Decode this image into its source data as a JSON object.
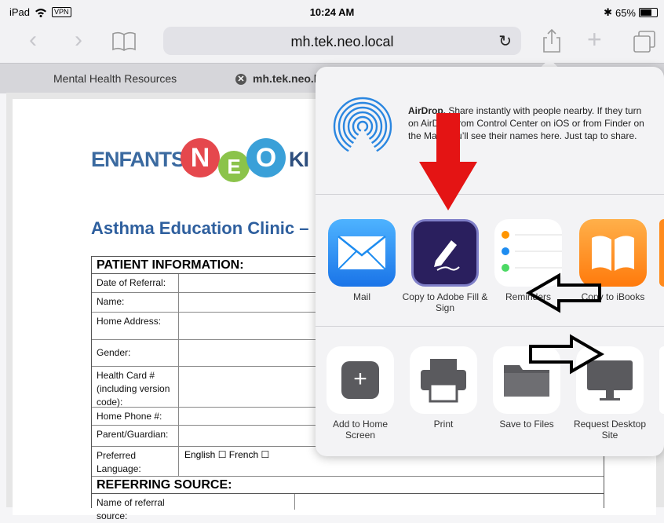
{
  "status_bar": {
    "device": "iPad",
    "vpn": "VPN",
    "time": "10:24 AM",
    "battery": "65%",
    "battery_level": 0.65
  },
  "toolbar": {
    "url": "mh.tek.neo.local"
  },
  "tabs": [
    {
      "label": "Mental Health Resources"
    },
    {
      "label": "mh.tek.neo.l"
    }
  ],
  "document": {
    "logo_prefix": "ENFANTS",
    "logo_letters": [
      "N",
      "E",
      "O"
    ],
    "logo_suffix": "KI",
    "title": "Asthma Education Clinic –",
    "sections": {
      "patient": "PATIENT INFORMATION:",
      "referring": "REFERRING SOURCE:"
    },
    "fields": [
      "Date of Referral:",
      "Name:",
      "Home Address:",
      "Gender:",
      "Health Card # (including version code):",
      "Home Phone #:",
      "Parent/Guardian:",
      "Preferred Language:"
    ],
    "language_options": "English ☐  French ☐",
    "referral_field": "Name of referral source:"
  },
  "share_sheet": {
    "airdrop_title": "AirDrop.",
    "airdrop_text": "Share instantly with people nearby. If they turn on AirDrop from Control Center on iOS or from Finder on the Mac, you’ll see their names here. Just tap to share.",
    "apps": [
      {
        "label": "Mail"
      },
      {
        "label": "Copy to Adobe Fill & Sign"
      },
      {
        "label": "Reminders"
      },
      {
        "label": "Copy to iBooks"
      }
    ],
    "actions": [
      {
        "label": "Add to Home Screen"
      },
      {
        "label": "Print"
      },
      {
        "label": "Save to Files"
      },
      {
        "label": "Request Desktop Site"
      }
    ]
  },
  "colors": {
    "mail": "#1e8cf0",
    "adobe": "#2a1f5e",
    "ibooks": "#ff8a1c",
    "annotation_red": "#e41414"
  }
}
